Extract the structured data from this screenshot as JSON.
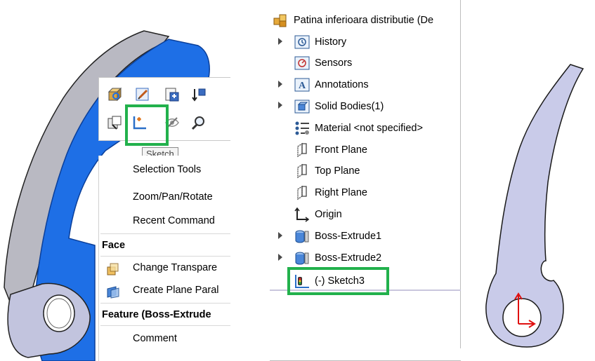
{
  "toolbar": {
    "tooltip": "Sketch",
    "buttons": [
      "zoom-to-selection-icon",
      "edit-feature-icon",
      "edit-sketch-icon",
      "rollback-icon",
      "normal-to-icon",
      "sketch-icon",
      "hide-icon",
      "zoom-icon"
    ]
  },
  "context_menu": {
    "items": [
      {
        "label": "Selection Tools"
      },
      {
        "label": "Zoom/Pan/Rotate"
      },
      {
        "label": "Recent Command"
      }
    ],
    "section_face": "Face",
    "face_items": [
      {
        "label": "Change Transpare"
      },
      {
        "label": "Create Plane Paral"
      }
    ],
    "section_feature": "Feature (Boss-Extrude",
    "feature_items": [
      {
        "label": "Comment"
      }
    ]
  },
  "tree": {
    "root": "Patina inferioara  distributie (De",
    "items": [
      {
        "label": "History",
        "icon": "history-icon",
        "expandable": true
      },
      {
        "label": "Sensors",
        "icon": "sensors-icon",
        "expandable": false
      },
      {
        "label": "Annotations",
        "icon": "annotations-icon",
        "expandable": true
      },
      {
        "label": "Solid Bodies(1)",
        "icon": "solid-bodies-icon",
        "expandable": true
      },
      {
        "label": "Material <not specified>",
        "icon": "material-icon",
        "expandable": false
      },
      {
        "label": "Front Plane",
        "icon": "plane-icon",
        "expandable": false
      },
      {
        "label": "Top Plane",
        "icon": "plane-icon",
        "expandable": false
      },
      {
        "label": "Right Plane",
        "icon": "plane-icon",
        "expandable": false
      },
      {
        "label": "Origin",
        "icon": "origin-icon",
        "expandable": false
      },
      {
        "label": "Boss-Extrude1",
        "icon": "extrude-icon",
        "expandable": true
      },
      {
        "label": "Boss-Extrude2",
        "icon": "extrude-icon",
        "expandable": true
      },
      {
        "label": "(-) Sketch3",
        "icon": "sketch-icon",
        "expandable": false
      }
    ]
  },
  "colors": {
    "highlight": "#22b14c",
    "selected_face": "#1e6fe6",
    "part_face": "#c7c9e8",
    "sketch_fill": "#c9cbe9",
    "origin": "#e01010"
  }
}
